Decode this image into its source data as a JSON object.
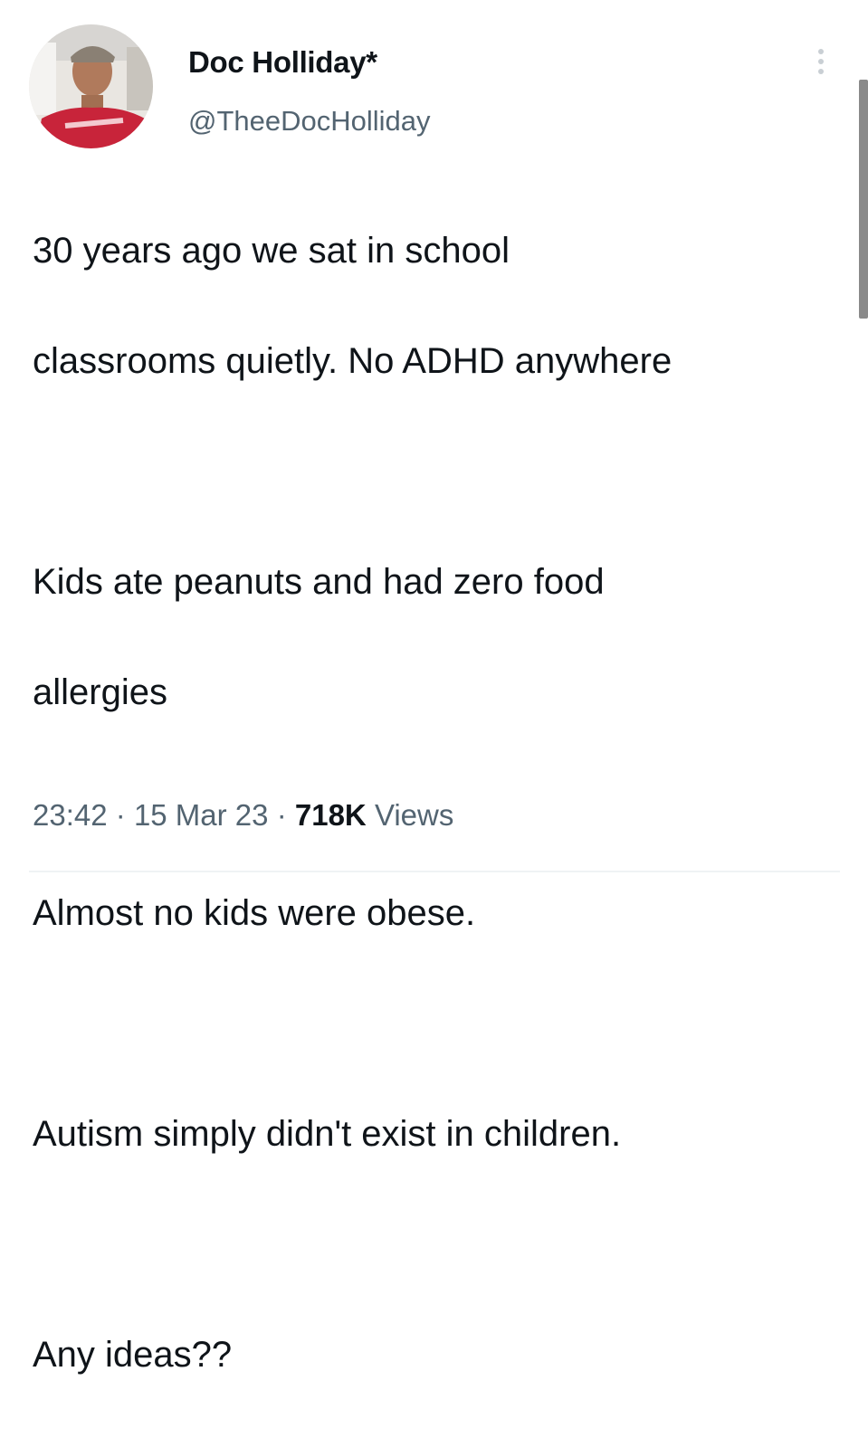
{
  "author": {
    "display_name": "Doc Holliday*",
    "handle": "@TheeDocHolliday",
    "avatar_icon": "profile-photo-icon"
  },
  "tweet": {
    "lines": [
      "30 years ago we sat in school",
      "classrooms quietly. No ADHD anywhere",
      "",
      "Kids ate peanuts and had zero food",
      "allergies",
      "",
      "Almost no kids were obese.",
      "",
      "Autism simply didn't exist in children.",
      "",
      "Any ideas??"
    ]
  },
  "meta": {
    "time": "23:42",
    "separator": "·",
    "date": "15 Mar 23",
    "views_count": "718K",
    "views_label": "Views"
  },
  "colors": {
    "text": "#0f1419",
    "secondary": "#536471",
    "divider": "#eff3f4"
  }
}
